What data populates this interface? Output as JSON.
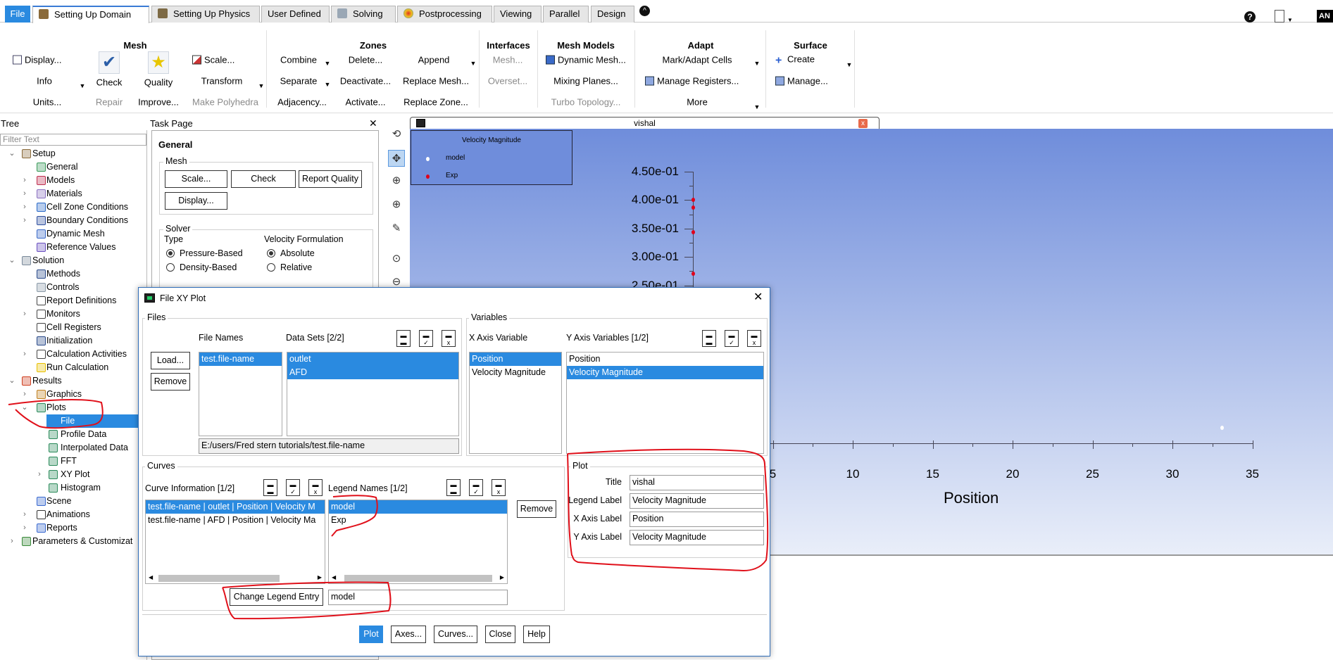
{
  "tabs": [
    {
      "label": "File"
    },
    {
      "label": "Setting Up Domain"
    },
    {
      "label": "Setting Up Physics"
    },
    {
      "label": "User Defined"
    },
    {
      "label": "Solving"
    },
    {
      "label": "Postprocessing"
    },
    {
      "label": "Viewing"
    },
    {
      "label": "Parallel"
    },
    {
      "label": "Design"
    }
  ],
  "logo_text": "AN",
  "ribbon": {
    "mesh": {
      "title": "Mesh",
      "display": "Display...",
      "info": "Info",
      "units": "Units...",
      "check": "Check",
      "repair": "Repair",
      "quality": "Quality",
      "improve": "Improve...",
      "scale": "Scale...",
      "transform": "Transform",
      "polyhedra": "Make Polyhedra"
    },
    "zones": {
      "title": "Zones",
      "combine": "Combine",
      "separate": "Separate",
      "adjacency": "Adjacency...",
      "delete": "Delete...",
      "deactivate": "Deactivate...",
      "activate": "Activate...",
      "append": "Append",
      "replace_mesh": "Replace Mesh...",
      "replace_zone": "Replace Zone..."
    },
    "interfaces": {
      "title": "Interfaces",
      "mesh": "Mesh...",
      "overset": "Overset..."
    },
    "mesh_models": {
      "title": "Mesh Models",
      "dynamic": "Dynamic Mesh...",
      "mixing": "Mixing Planes...",
      "turbo": "Turbo Topology..."
    },
    "adapt": {
      "title": "Adapt",
      "mark": "Mark/Adapt Cells",
      "manage": "Manage Registers...",
      "more": "More"
    },
    "surface": {
      "title": "Surface",
      "create": "Create",
      "manage": "Manage..."
    }
  },
  "tree": {
    "header": "Tree",
    "filter_placeholder": "Filter Text",
    "items": [
      {
        "label": "Setup"
      },
      {
        "label": "General"
      },
      {
        "label": "Models"
      },
      {
        "label": "Materials"
      },
      {
        "label": "Cell Zone Conditions"
      },
      {
        "label": "Boundary Conditions"
      },
      {
        "label": "Dynamic Mesh"
      },
      {
        "label": "Reference Values"
      },
      {
        "label": "Solution"
      },
      {
        "label": "Methods"
      },
      {
        "label": "Controls"
      },
      {
        "label": "Report Definitions"
      },
      {
        "label": "Monitors"
      },
      {
        "label": "Cell Registers"
      },
      {
        "label": "Initialization"
      },
      {
        "label": "Calculation Activities"
      },
      {
        "label": "Run Calculation"
      },
      {
        "label": "Results"
      },
      {
        "label": "Graphics"
      },
      {
        "label": "Plots"
      },
      {
        "label": "File"
      },
      {
        "label": "Profile Data"
      },
      {
        "label": "Interpolated Data"
      },
      {
        "label": "FFT"
      },
      {
        "label": "XY Plot"
      },
      {
        "label": "Histogram"
      },
      {
        "label": "Scene"
      },
      {
        "label": "Animations"
      },
      {
        "label": "Reports"
      },
      {
        "label": "Parameters & Customizat"
      }
    ]
  },
  "task": {
    "header": "Task Page",
    "title": "General",
    "mesh_group": "Mesh",
    "scale": "Scale...",
    "check": "Check",
    "report_quality": "Report Quality",
    "display": "Display...",
    "solver_group": "Solver",
    "type_label": "Type",
    "pressure": "Pressure-Based",
    "density": "Density-Based",
    "velocity_label": "Velocity Formulation",
    "absolute": "Absolute",
    "relative": "Relative"
  },
  "graphics": {
    "tab_title": "vishal",
    "legend_title": "Velocity Magnitude",
    "legend_items": [
      "model",
      "Exp"
    ]
  },
  "colors": {
    "model": "#ffffff",
    "exp": "#e0001a",
    "selection": "#2a8ae0",
    "annotation": "#e0101a"
  },
  "chart_data": {
    "type": "scatter",
    "title": "vishal",
    "xlabel": "Position",
    "ylabel": "Velocity Magnitude",
    "xlim": [
      0,
      35
    ],
    "ylim": [
      -0.028,
      0.45
    ],
    "xticks": [
      {
        "v": 5,
        "label": "5"
      },
      {
        "v": 10,
        "label": "10"
      },
      {
        "v": 15,
        "label": "15"
      },
      {
        "v": 20,
        "label": "20"
      },
      {
        "v": 25,
        "label": "25"
      },
      {
        "v": 30,
        "label": "30"
      },
      {
        "v": 35,
        "label": "35"
      }
    ],
    "yticks": [
      {
        "v": 0.45,
        "label": "4.50e-01"
      },
      {
        "v": 0.4,
        "label": "4.00e-01"
      },
      {
        "v": 0.35,
        "label": "3.50e-01"
      },
      {
        "v": 0.3,
        "label": "3.00e-01"
      },
      {
        "v": 0.25,
        "label": "2.50e-01"
      }
    ],
    "legend_position": "top-left",
    "series": [
      {
        "name": "model",
        "color": "#ffffff",
        "points": [
          [
            33.1,
            0.0
          ]
        ]
      },
      {
        "name": "Exp",
        "color": "#e0001a",
        "points": [
          [
            0,
            0.4
          ],
          [
            0,
            0.387
          ],
          [
            0,
            0.344
          ],
          [
            0,
            0.27
          ]
        ]
      }
    ]
  },
  "dialog": {
    "title": "File XY Plot",
    "files_group": "Files",
    "file_names_label": "File Names",
    "data_sets_label": "Data Sets [2/2]",
    "load": "Load...",
    "remove": "Remove",
    "file_names": [
      "test.file-name"
    ],
    "data_sets": [
      "outlet",
      "AFD"
    ],
    "path": "E:/users/Fred stern tutorials/test.file-name",
    "variables_group": "Variables",
    "x_axis_label": "X Axis Variable",
    "y_axis_label": "Y Axis Variables [1/2]",
    "x_vars": [
      "Position",
      "Velocity Magnitude"
    ],
    "y_vars": [
      "Position",
      "Velocity Magnitude"
    ],
    "curves_group": "Curves",
    "curve_info_label": "Curve Information [1/2]",
    "legend_names_label": "Legend Names [1/2]",
    "curves": [
      "test.file-name | outlet | Position | Velocity M",
      "test.file-name | AFD | Position | Velocity Ma"
    ],
    "legend_names": [
      "model",
      "Exp"
    ],
    "curves_remove": "Remove",
    "change_legend": "Change Legend Entry",
    "legend_entry_value": "model",
    "plot_group": "Plot",
    "title_label": "Title",
    "title_value": "vishal",
    "legend_label_label": "Legend Label",
    "legend_label_value": "Velocity Magnitude",
    "xaxis_label_label": "X Axis Label",
    "xaxis_label_value": "Position",
    "yaxis_label_label": "Y Axis Label",
    "yaxis_label_value": "Velocity Magnitude",
    "buttons": {
      "plot": "Plot",
      "axes": "Axes...",
      "curves": "Curves...",
      "close": "Close",
      "help": "Help"
    }
  }
}
